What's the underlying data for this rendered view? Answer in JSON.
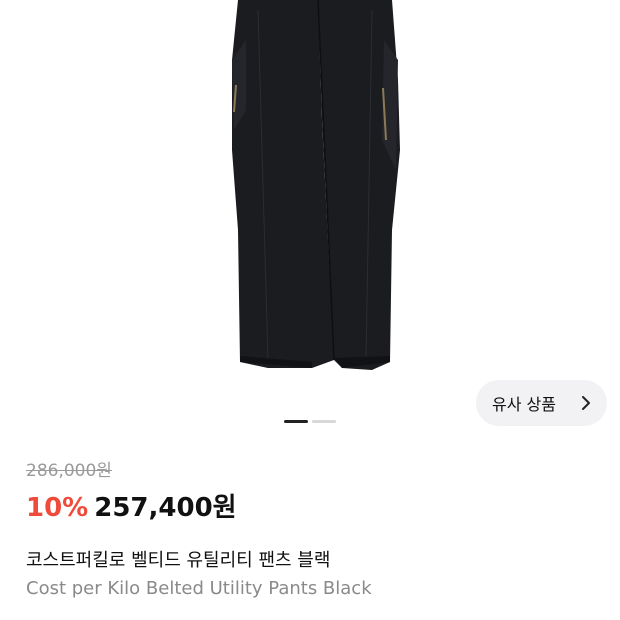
{
  "product": {
    "similar_button_label": "유사 상품",
    "original_price": "286,000원",
    "discount": "10%",
    "sale_price": "257,400원",
    "title_ko": "코스트퍼킬로 벨티드 유틸리티 팬츠 블랙",
    "title_en": "Cost per Kilo Belted Utility Pants Black",
    "image_count": 2,
    "active_image_index": 1
  },
  "colors": {
    "discount": "#ef4a3a",
    "price": "#111111",
    "muted": "#8a8a8a",
    "pants": "#1b1c20"
  },
  "icons": {
    "similar_chevron": "chevron-right-icon"
  }
}
